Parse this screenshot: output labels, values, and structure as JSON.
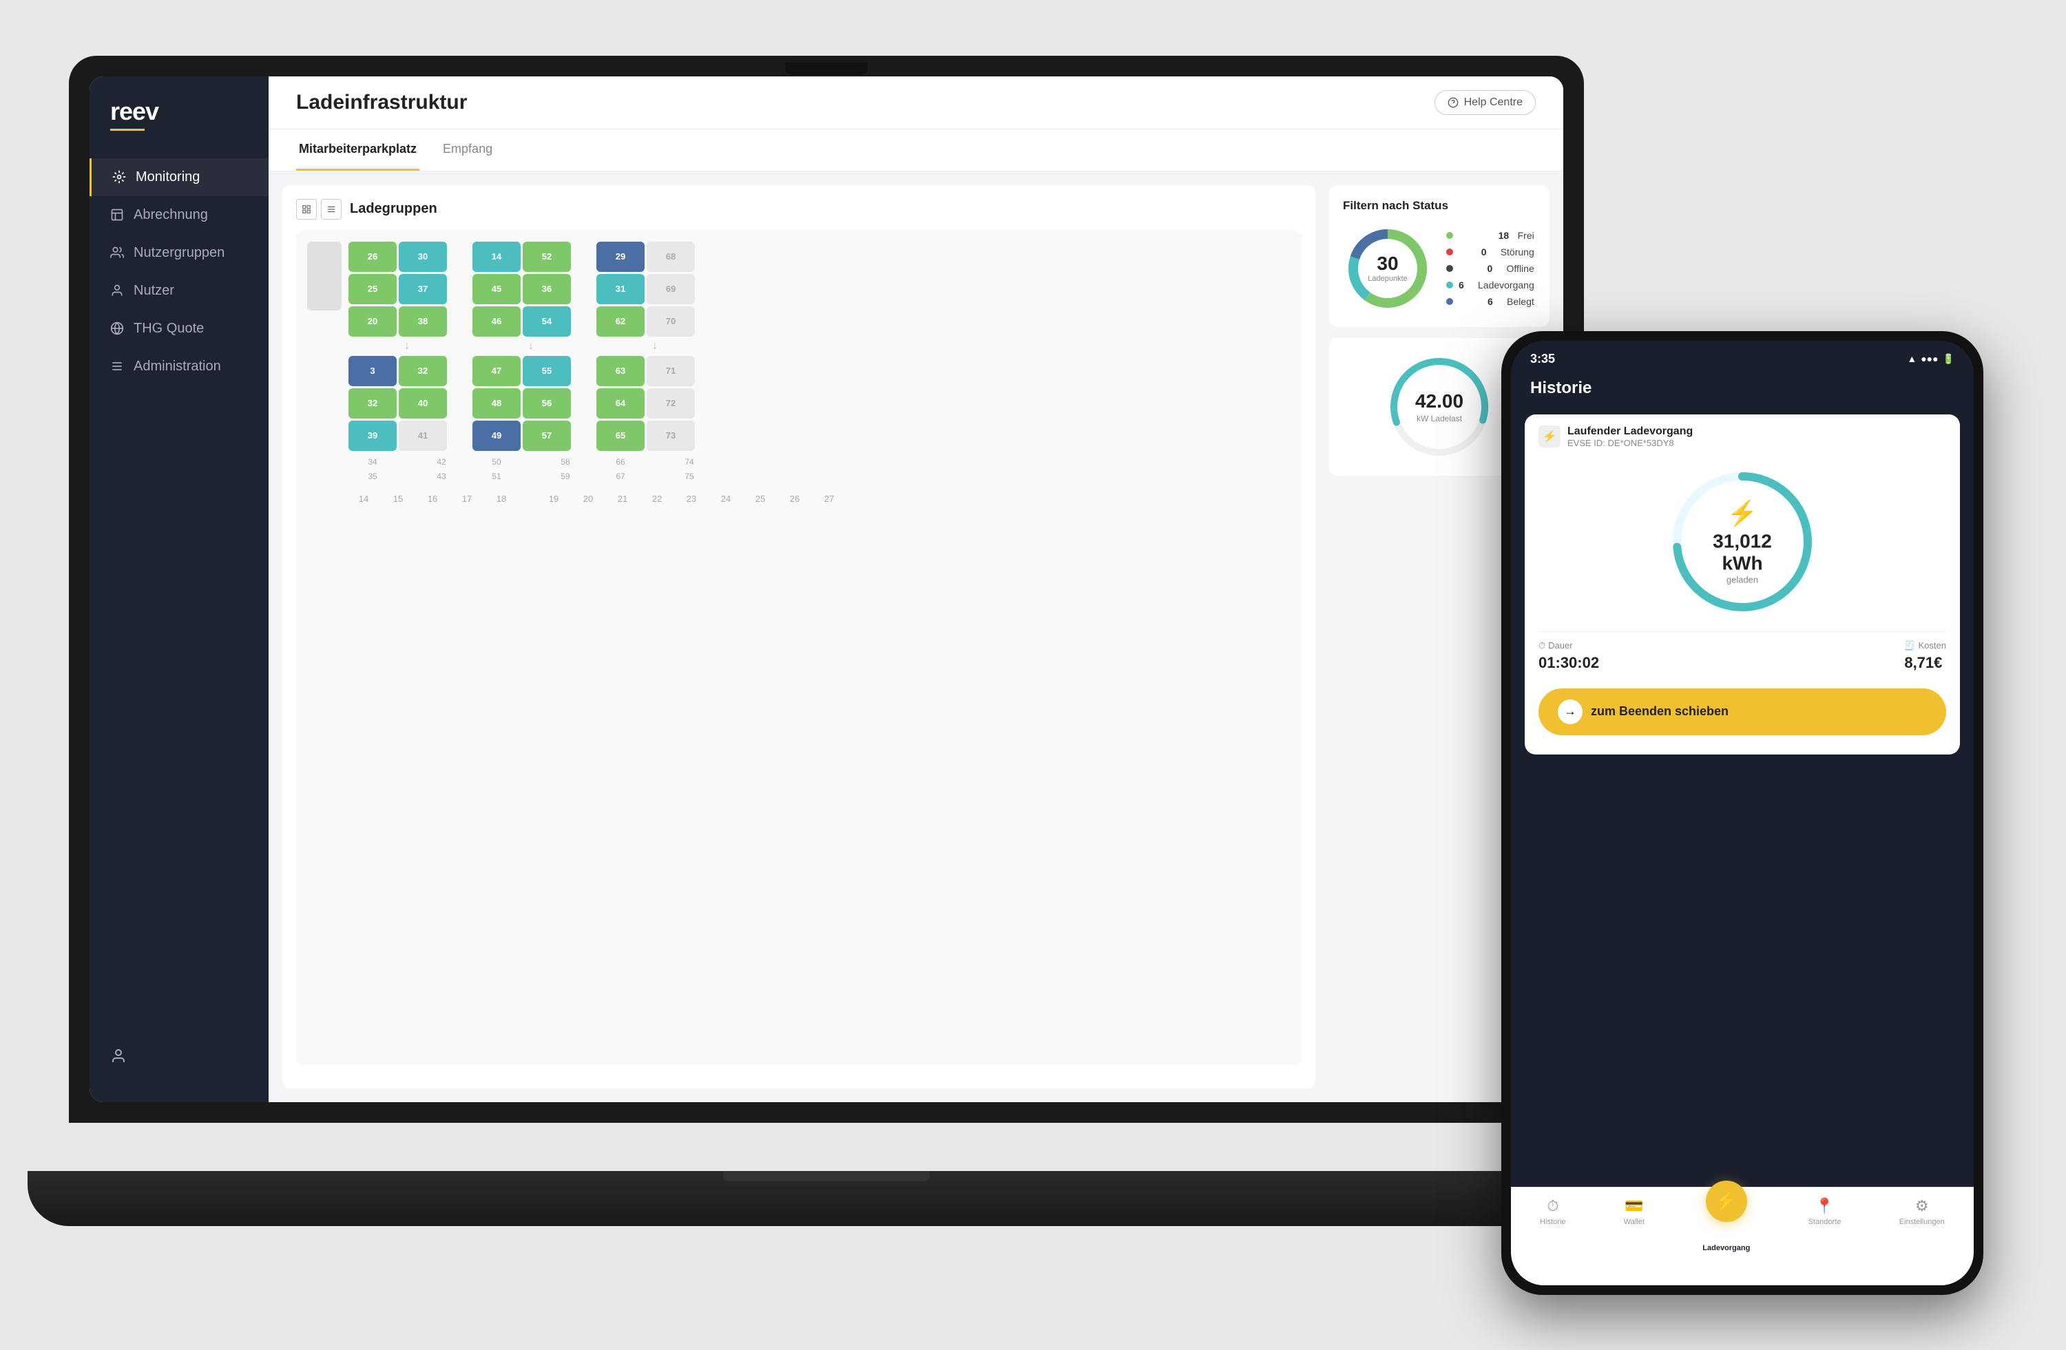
{
  "app": {
    "title": "Ladeinfrastruktur",
    "help_btn": "Help Centre"
  },
  "sidebar": {
    "logo": "reev",
    "items": [
      {
        "label": "Monitoring",
        "icon": "monitoring",
        "active": true
      },
      {
        "label": "Abrechnung",
        "icon": "abrechnung",
        "active": false
      },
      {
        "label": "Nutzergruppen",
        "icon": "nutzergruppen",
        "active": false
      },
      {
        "label": "Nutzer",
        "icon": "nutzer",
        "active": false
      },
      {
        "label": "THG Quote",
        "icon": "thg",
        "active": false
      },
      {
        "label": "Administration",
        "icon": "admin",
        "active": false
      }
    ]
  },
  "tabs": [
    {
      "label": "Mitarbeiterparkplatz",
      "active": true
    },
    {
      "label": "Empfang",
      "active": false
    }
  ],
  "ladegruppen": {
    "title": "Ladegruppen"
  },
  "status": {
    "title": "Filtern nach Status",
    "total": 30,
    "total_label": "Ladepunkte",
    "items": [
      {
        "label": "Frei",
        "count": 18,
        "color": "#7ec86a"
      },
      {
        "label": "Störung",
        "count": 0,
        "color": "#e04040"
      },
      {
        "label": "Offline",
        "count": 0,
        "color": "#444"
      },
      {
        "label": "Ladevorgang",
        "count": 6,
        "color": "#4bbfbf"
      },
      {
        "label": "Belegt",
        "count": 6,
        "color": "#4a6fa5"
      }
    ]
  },
  "ladelast": {
    "value": "42.00",
    "unit": "kW Ladelast"
  },
  "phone": {
    "time": "3:35",
    "header": "Historie",
    "charging": {
      "title": "Laufender Ladevorgang",
      "evse": "EVSE ID: DE*ONE*53DY8",
      "kwh": "31,012 kWh",
      "kwh_label": "geladen",
      "dauer_label": "Dauer",
      "dauer_value": "01:30:02",
      "kosten_label": "Kosten",
      "kosten_value": "8,71€",
      "stop_text": "zum Beenden schieben"
    },
    "nav": [
      {
        "label": "Historie",
        "icon": "⏱",
        "active": false
      },
      {
        "label": "Wallet",
        "icon": "💳",
        "active": false
      },
      {
        "label": "Ladevorgang",
        "icon": "⚡",
        "active": true,
        "center": true
      },
      {
        "label": "Standorte",
        "icon": "📍",
        "active": false
      },
      {
        "label": "Einstellungen",
        "icon": "⚙",
        "active": false
      }
    ]
  },
  "parking_slots": {
    "cols": [
      {
        "slots": [
          {
            "num": "26",
            "type": "green"
          },
          {
            "num": "25",
            "type": "green"
          },
          {
            "num": "20",
            "type": "green"
          },
          {
            "num": "3",
            "type": "blue"
          },
          {
            "num": "32",
            "type": "green"
          },
          {
            "num": "39",
            "type": "teal"
          }
        ],
        "numbers": [
          "34",
          "35"
        ]
      },
      {
        "slots": [
          {
            "num": "30",
            "type": "teal"
          },
          {
            "num": "37",
            "type": "teal"
          },
          {
            "num": "38",
            "type": "green"
          },
          {
            "num": "32",
            "type": "green"
          },
          {
            "num": "40",
            "type": "green"
          },
          {
            "num": "41",
            "type": "empty"
          }
        ],
        "numbers": [
          "42",
          "43"
        ]
      }
    ]
  }
}
